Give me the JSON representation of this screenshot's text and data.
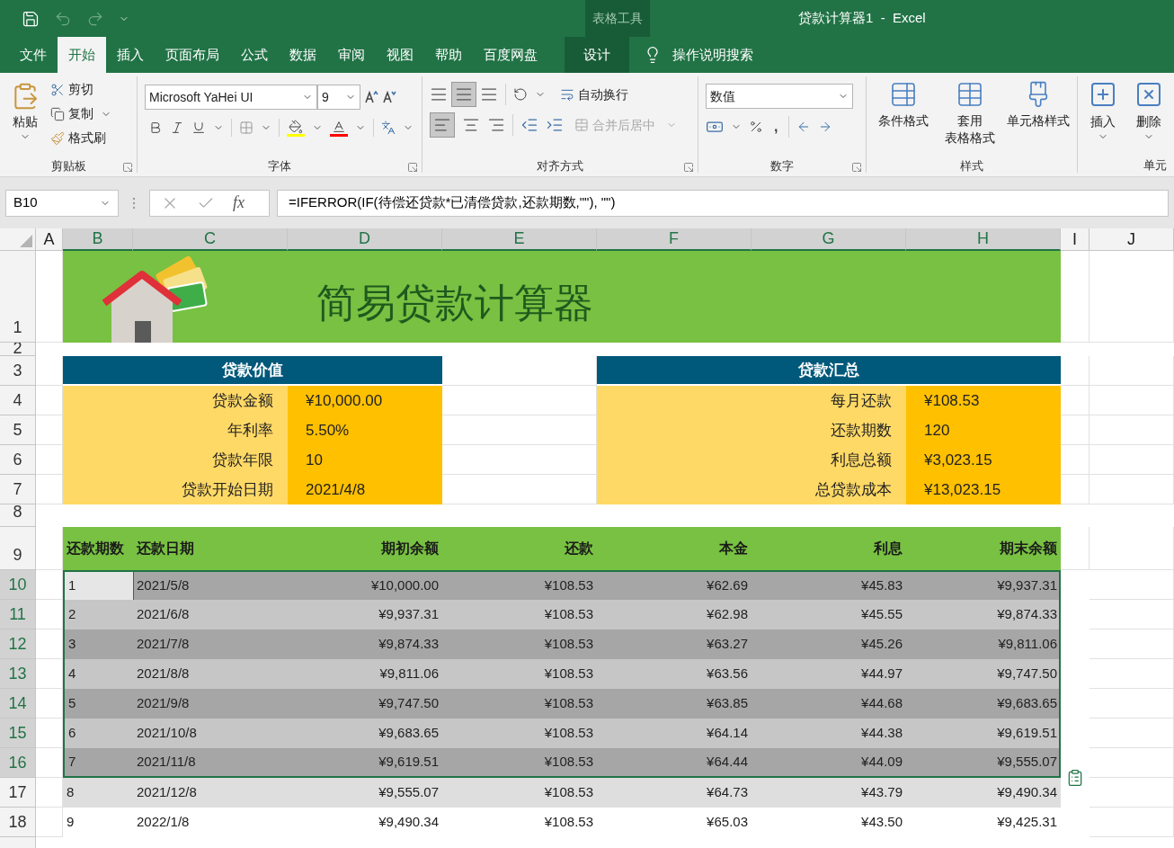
{
  "title_bar": {
    "context_group": "表格工具",
    "title": "贷款计算器1  -  Excel"
  },
  "tabs": [
    {
      "label": "文件",
      "selected": false,
      "kind": "normal"
    },
    {
      "label": "开始",
      "selected": true,
      "kind": "normal"
    },
    {
      "label": "插入",
      "selected": false,
      "kind": "normal"
    },
    {
      "label": "页面布局",
      "selected": false,
      "kind": "normal"
    },
    {
      "label": "公式",
      "selected": false,
      "kind": "normal"
    },
    {
      "label": "数据",
      "selected": false,
      "kind": "normal"
    },
    {
      "label": "审阅",
      "selected": false,
      "kind": "normal"
    },
    {
      "label": "视图",
      "selected": false,
      "kind": "normal"
    },
    {
      "label": "帮助",
      "selected": false,
      "kind": "normal"
    },
    {
      "label": "百度网盘",
      "selected": false,
      "kind": "normal"
    },
    {
      "label": "设计",
      "selected": false,
      "kind": "contextual"
    }
  ],
  "search": {
    "label": "操作说明搜索"
  },
  "ribbon": {
    "clipboard": {
      "label": "剪贴板",
      "paste": "粘贴",
      "cut": "剪切",
      "copy": "复制",
      "format_painter": "格式刷"
    },
    "font": {
      "label": "字体",
      "font_name": "Microsoft YaHei UI",
      "font_size": "9"
    },
    "alignment": {
      "label": "对齐方式",
      "wrap_text": "自动换行",
      "merge": {
        "label": "合并后居中",
        "disabled": true
      }
    },
    "number": {
      "label": "数字",
      "format": "数值",
      "comma": ","
    },
    "styles": {
      "label": "样式",
      "buttons": [
        [
          "条件格式"
        ],
        [
          "套用",
          "表格格式"
        ],
        [
          "单元格样式"
        ]
      ]
    },
    "cells": {
      "label": "单元",
      "insert": "插入",
      "delete": "删除"
    }
  },
  "formula_bar": {
    "name_box": "B10",
    "fx": "fx",
    "formula": "=IFERROR(IF(待偿还贷款*已清偿贷款,还款期数,\"\"), \"\")"
  },
  "columns": [
    {
      "label": "A",
      "selected": false
    },
    {
      "label": "B",
      "selected": true
    },
    {
      "label": "C",
      "selected": true
    },
    {
      "label": "D",
      "selected": true
    },
    {
      "label": "E",
      "selected": true
    },
    {
      "label": "F",
      "selected": true
    },
    {
      "label": "G",
      "selected": true
    },
    {
      "label": "H",
      "selected": true
    },
    {
      "label": "I",
      "selected": false
    },
    {
      "label": "J",
      "selected": false
    }
  ],
  "row_numbers": [
    "1",
    "2",
    "3",
    "4",
    "5",
    "6",
    "7",
    "8",
    "9"
  ],
  "banner": {
    "title": "简易贷款计算器"
  },
  "loan_value": {
    "title": "贷款价值",
    "items": [
      {
        "label": "贷款金额",
        "value": "¥10,000.00"
      },
      {
        "label": "年利率",
        "value": "5.50%"
      },
      {
        "label": "贷款年限",
        "value": "10"
      },
      {
        "label": "贷款开始日期",
        "value": "2021/4/8"
      }
    ]
  },
  "loan_summary": {
    "title": "贷款汇总",
    "items": [
      {
        "label": "每月还款",
        "value": "¥108.53"
      },
      {
        "label": "还款期数",
        "value": "120"
      },
      {
        "label": "利息总额",
        "value": "¥3,023.15"
      },
      {
        "label": "总贷款成本",
        "value": "¥13,023.15"
      }
    ]
  },
  "schedule": {
    "columns": [
      "还款期数",
      "还款日期",
      "期初余额",
      "还款",
      "本金",
      "利息",
      "期末余额"
    ],
    "rows": [
      {
        "row": "10",
        "selected": true,
        "active": true,
        "cells": [
          "1",
          "2021/5/8",
          "¥10,000.00",
          "¥108.53",
          "¥62.69",
          "¥45.83",
          "¥9,937.31"
        ]
      },
      {
        "row": "11",
        "selected": true,
        "active": false,
        "cells": [
          "2",
          "2021/6/8",
          "¥9,937.31",
          "¥108.53",
          "¥62.98",
          "¥45.55",
          "¥9,874.33"
        ]
      },
      {
        "row": "12",
        "selected": true,
        "active": false,
        "cells": [
          "3",
          "2021/7/8",
          "¥9,874.33",
          "¥108.53",
          "¥63.27",
          "¥45.26",
          "¥9,811.06"
        ]
      },
      {
        "row": "13",
        "selected": true,
        "active": false,
        "cells": [
          "4",
          "2021/8/8",
          "¥9,811.06",
          "¥108.53",
          "¥63.56",
          "¥44.97",
          "¥9,747.50"
        ]
      },
      {
        "row": "14",
        "selected": true,
        "active": false,
        "cells": [
          "5",
          "2021/9/8",
          "¥9,747.50",
          "¥108.53",
          "¥63.85",
          "¥44.68",
          "¥9,683.65"
        ]
      },
      {
        "row": "15",
        "selected": true,
        "active": false,
        "cells": [
          "6",
          "2021/10/8",
          "¥9,683.65",
          "¥108.53",
          "¥64.14",
          "¥44.38",
          "¥9,619.51"
        ]
      },
      {
        "row": "16",
        "selected": true,
        "active": false,
        "cells": [
          "7",
          "2021/11/8",
          "¥9,619.51",
          "¥108.53",
          "¥64.44",
          "¥44.09",
          "¥9,555.07"
        ]
      },
      {
        "row": "17",
        "selected": false,
        "active": false,
        "cells": [
          "8",
          "2021/12/8",
          "¥9,555.07",
          "¥108.53",
          "¥64.73",
          "¥43.79",
          "¥9,490.34"
        ]
      },
      {
        "row": "18",
        "selected": false,
        "active": false,
        "cells": [
          "9",
          "2022/1/8",
          "¥9,490.34",
          "¥108.53",
          "¥65.03",
          "¥43.50",
          "¥9,425.31"
        ]
      }
    ]
  }
}
